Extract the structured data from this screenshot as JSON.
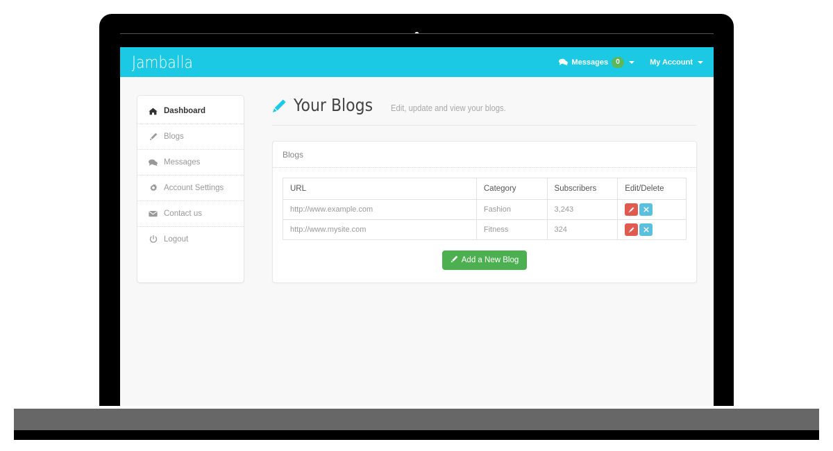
{
  "navbar": {
    "brand": "Jamballa",
    "messages_label": "Messages",
    "messages_badge": "0",
    "messages_icon": "comments-icon",
    "account_label": "My Account",
    "brand_color": "#1bc9e4",
    "badge_color": "#5cb85c"
  },
  "sidebar": {
    "items": [
      {
        "label": "Dashboard",
        "icon": "home-icon",
        "active": true
      },
      {
        "label": "Blogs",
        "icon": "pencil-icon",
        "active": false
      },
      {
        "label": "Messages",
        "icon": "comments-icon",
        "active": false
      },
      {
        "label": "Account Settings",
        "icon": "gear-icon",
        "active": false
      },
      {
        "label": "Contact us",
        "icon": "envelope-icon",
        "active": false
      },
      {
        "label": "Logout",
        "icon": "power-icon",
        "active": false
      }
    ]
  },
  "header": {
    "icon": "pencil-icon",
    "title": "Your Blogs",
    "subtitle": "Edit, update and view your blogs."
  },
  "panel": {
    "heading": "Blogs",
    "table": {
      "columns": [
        "URL",
        "Category",
        "Subscribers",
        "Edit/Delete"
      ],
      "rows": [
        {
          "url": "http://www.example.com",
          "category": "Fashion",
          "subscribers": "3,243",
          "edit_icon": "pencil-icon",
          "delete_icon": "close-icon"
        },
        {
          "url": "http://www.mysite.com",
          "category": "Fitness",
          "subscribers": "324",
          "edit_icon": "pencil-icon",
          "delete_icon": "close-icon"
        }
      ]
    },
    "add_button": {
      "label": "Add a New Blog",
      "icon": "pencil-icon",
      "color": "#4cb050"
    },
    "edit_button_color": "#e05a4f",
    "delete_button_color": "#5bc0de"
  }
}
